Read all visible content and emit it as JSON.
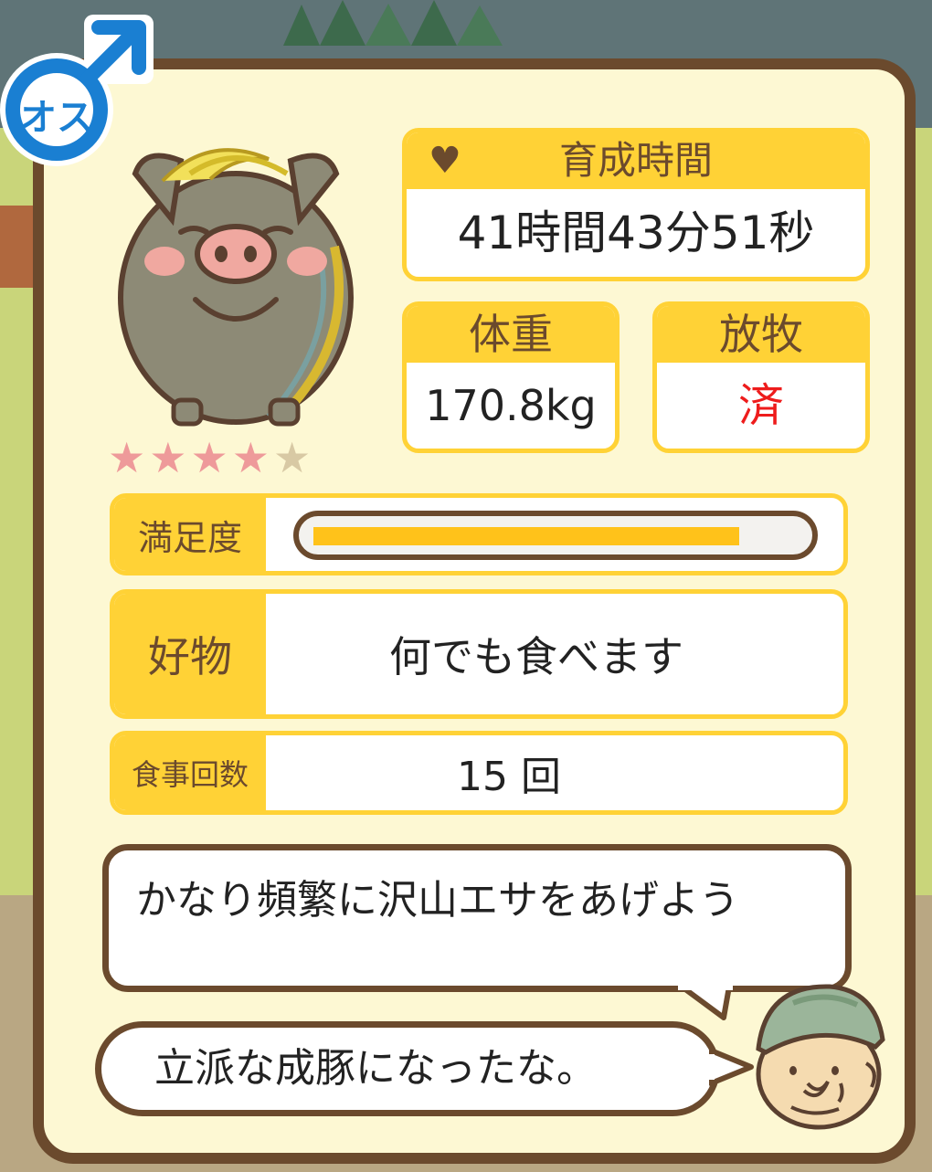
{
  "gender_badge": {
    "label": "オス",
    "icon": "male-symbol-icon",
    "color": "#1a7fd2"
  },
  "pig": {
    "icon": "pig-icon",
    "rating": 4,
    "rating_max": 5,
    "stars": [
      {
        "glyph": "★",
        "on": true
      },
      {
        "glyph": "★",
        "on": true
      },
      {
        "glyph": "★",
        "on": true
      },
      {
        "glyph": "★",
        "on": true
      },
      {
        "glyph": "★",
        "on": false
      }
    ]
  },
  "stats": {
    "raise_time": {
      "label": "育成時間",
      "value": "41時間43分51秒",
      "icon": "heart-icon"
    },
    "weight": {
      "label": "体重",
      "value": "170.8kg"
    },
    "grazing": {
      "label": "放牧",
      "value": "済"
    }
  },
  "satisfaction": {
    "label": "満足度",
    "level": 0.88
  },
  "favorite": {
    "label": "好物",
    "value": "何でも食べます"
  },
  "meals": {
    "label": "食事回数",
    "value": "15 回"
  },
  "advice": {
    "text": "かなり頻繁に沢山エサをあげよう"
  },
  "farmer": {
    "quote": "立派な成豚になったな。",
    "icon": "farmer-face-icon"
  },
  "colors": {
    "accent": "#ffd236",
    "border": "#6b4a2d",
    "panel": "#fdf8d3",
    "done": "#ee1c1c",
    "gauge": "#ffc21a"
  }
}
